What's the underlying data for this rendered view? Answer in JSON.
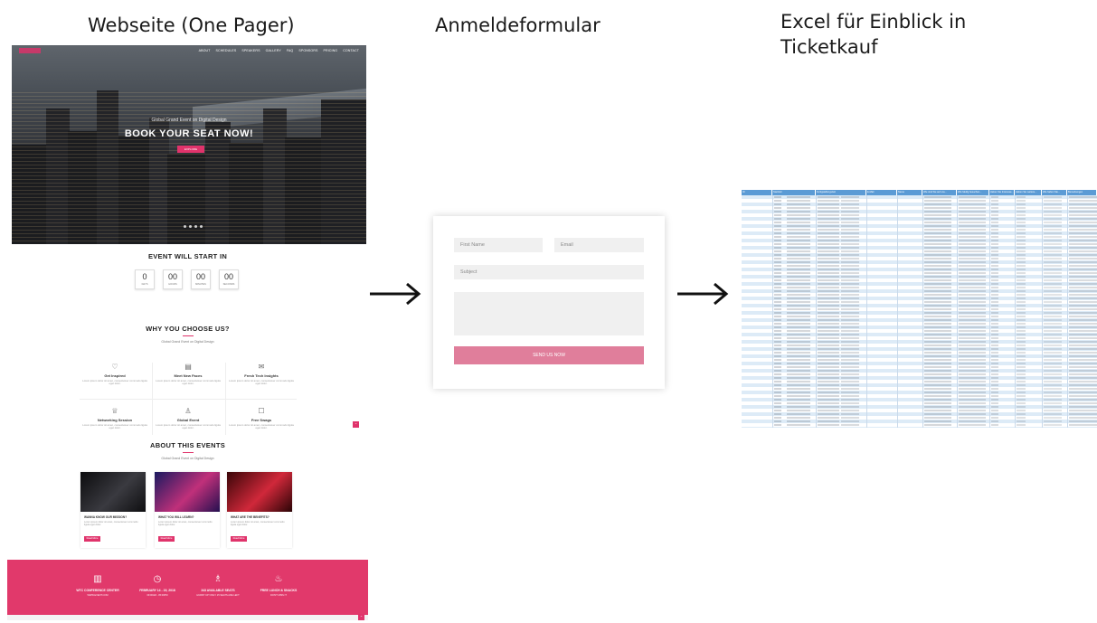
{
  "titles": {
    "website": "Webseite (One Pager)",
    "form": "Anmeldeformular",
    "excel_line1": "Excel für Einblick in",
    "excel_line2": "Ticketkauf"
  },
  "website": {
    "nav": [
      "ABOUT",
      "SCHEDULES",
      "SPEAKERS",
      "GALLERY",
      "FAQ",
      "SPONSORS",
      "PRICING",
      "CONTACT"
    ],
    "hero_kicker": "Global Grand Event on Digital Design",
    "hero_title": "BOOK YOUR SEAT NOW!",
    "hero_button": "EXPLORE",
    "countdown_title": "EVENT WILL START IN",
    "countdown": [
      {
        "num": "0",
        "label": "DAYS"
      },
      {
        "num": "00",
        "label": "HOURS"
      },
      {
        "num": "00",
        "label": "MINUTES"
      },
      {
        "num": "00",
        "label": "SECONDS"
      }
    ],
    "why_title": "WHY YOU CHOOSE US?",
    "why_sub": "Global Grand Event on Digital Design",
    "features": [
      {
        "icon": "heart-icon",
        "glyph": "♡",
        "title": "Get Inspired",
        "desc": "Lorem ipsum dolor sit amet, consectetuer commodo ligula eget dolor."
      },
      {
        "icon": "news-icon",
        "glyph": "▤",
        "title": "Meet New Faces",
        "desc": "Lorem ipsum dolor sit amet, consectetuer commodo ligula eget dolor."
      },
      {
        "icon": "mail-icon",
        "glyph": "✉",
        "title": "Fresh Tech Insights",
        "desc": "Lorem ipsum dolor sit amet, consectetuer commodo ligula eget dolor."
      },
      {
        "icon": "trophy-icon",
        "glyph": "♕",
        "title": "Networking Session",
        "desc": "Lorem ipsum dolor sit amet, consectetuer commodo ligula eget dolor."
      },
      {
        "icon": "user-icon",
        "glyph": "♙",
        "title": "Global Event",
        "desc": "Lorem ipsum dolor sit amet, consectetuer commodo ligula eget dolor."
      },
      {
        "icon": "chat-icon",
        "glyph": "☐",
        "title": "Free Swags",
        "desc": "Lorem ipsum dolor sit amet, consectetuer commodo ligula eget dolor."
      }
    ],
    "about_title": "ABOUT THIS EVENTS",
    "about_sub": "Global Grand Event on Digital Design",
    "cards": [
      {
        "title": "WANNA KNOW OUR MISSION?",
        "desc": "Lorem ipsum dolor sit amet, consectetuer commodo ligula eget dolor.",
        "button": "Read More",
        "color_a": "#0c0c0e",
        "color_b": "#3a3a40"
      },
      {
        "title": "WHAT YOU WILL LEARN?",
        "desc": "Lorem ipsum dolor sit amet, consectetuer commodo ligula eget dolor.",
        "button": "Read More",
        "color_a": "#1a1a60",
        "color_b": "#c0307a"
      },
      {
        "title": "WHAT ARE THE BENEFITS?",
        "desc": "Lorem ipsum dolor sit amet, consectetuer commodo ligula eget dolor.",
        "button": "Read More",
        "color_a": "#3a0608",
        "color_b": "#d0283a"
      }
    ],
    "footer": [
      {
        "icon": "building-icon",
        "glyph": "▥",
        "title": "WTC CONFERENCE CENTER",
        "sub": "WWW.EVENT.COM"
      },
      {
        "icon": "clock-icon",
        "glyph": "◷",
        "title": "FEBRUARY 14 - 19, 2018",
        "sub": "09:00AM - 05:00PM"
      },
      {
        "icon": "people-icon",
        "glyph": "♗",
        "title": "343 AVAILABLE SEATS",
        "sub": "HURRY UP! ONLY 15 SEATS ARE LEFT"
      },
      {
        "icon": "coffee-icon",
        "glyph": "♨",
        "title": "FREE LUNCH & SNACKS",
        "sub": "DON'T MISS IT"
      }
    ],
    "accent": "#e0336b"
  },
  "form": {
    "first_name_placeholder": "First Name",
    "email_placeholder": "Email",
    "subject_placeholder": "Subject",
    "message_placeholder": "",
    "submit_label": "SEND US NOW",
    "button_color": "#e07e9b"
  },
  "excel": {
    "headers": [
      "ID",
      "Startzeit",
      "Fertigstellungszeit",
      "E-Mail",
      "Name",
      "Wie sind Sie auf uns...",
      "Wie häufig besuchen...",
      "Haben Sie Interesse...",
      "Haben Sie weitere...",
      "Wie haben Sie...",
      "Bemerkungen"
    ],
    "header_color": "#5b9bd5",
    "band_color": "#ddebf7"
  }
}
